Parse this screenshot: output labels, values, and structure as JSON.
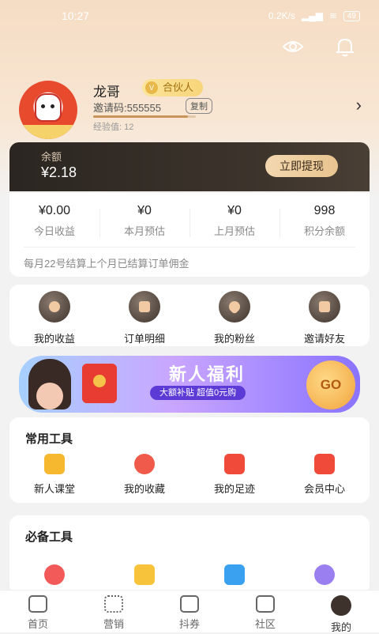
{
  "status": {
    "time": "10:27",
    "network": "0.2K/s",
    "battery": "49"
  },
  "profile": {
    "name": "龙哥",
    "badge": "合伙人",
    "badge_icon": "V",
    "invite": "邀请码:555555",
    "copy_label": "复制",
    "exp": "经验值: 12",
    "exp_progress": 0.92
  },
  "balance": {
    "label": "余额",
    "value": "¥2.18",
    "button": "立即提现"
  },
  "stats": [
    {
      "value": "¥0.00",
      "label": "今日收益"
    },
    {
      "value": "¥0",
      "label": "本月预估"
    },
    {
      "value": "¥0",
      "label": "上月预估"
    },
    {
      "value": "998",
      "label": "积分余额"
    }
  ],
  "settle_note": "每月22号结算上个月已结算订单佣金",
  "quick": [
    {
      "label": "我的收益",
      "icon": "coin-icon"
    },
    {
      "label": "订单明细",
      "icon": "order-icon"
    },
    {
      "label": "我的粉丝",
      "icon": "heart-icon"
    },
    {
      "label": "邀请好友",
      "icon": "invite-icon"
    }
  ],
  "banner": {
    "title": "新人福利",
    "subtitle": "大额补贴 超值0元购",
    "go": "GO"
  },
  "common_tools": {
    "title": "常用工具",
    "items": [
      {
        "label": "新人课堂",
        "icon": "graduation-cap-icon",
        "color": "#f5b82e"
      },
      {
        "label": "我的收藏",
        "icon": "star-icon",
        "color": "#f05a4a"
      },
      {
        "label": "我的足迹",
        "icon": "flag-icon",
        "color": "#f04a3a"
      },
      {
        "label": "会员中心",
        "icon": "crown-icon",
        "color": "#f04a3a"
      }
    ]
  },
  "essential_tools": {
    "title": "必备工具",
    "items": [
      {
        "icon": "chat-icon",
        "color": "#f25a5a"
      },
      {
        "icon": "document-icon",
        "color": "#f6c33a"
      },
      {
        "icon": "help-icon",
        "color": "#3aa0f0"
      },
      {
        "icon": "info-icon",
        "color": "#9a7ff0"
      }
    ]
  },
  "nav": [
    {
      "label": "首页",
      "icon": "home-icon"
    },
    {
      "label": "营销",
      "icon": "grid-icon"
    },
    {
      "label": "抖券",
      "icon": "ticket-icon"
    },
    {
      "label": "社区",
      "icon": "community-icon"
    },
    {
      "label": "我的",
      "icon": "profile-icon"
    }
  ]
}
